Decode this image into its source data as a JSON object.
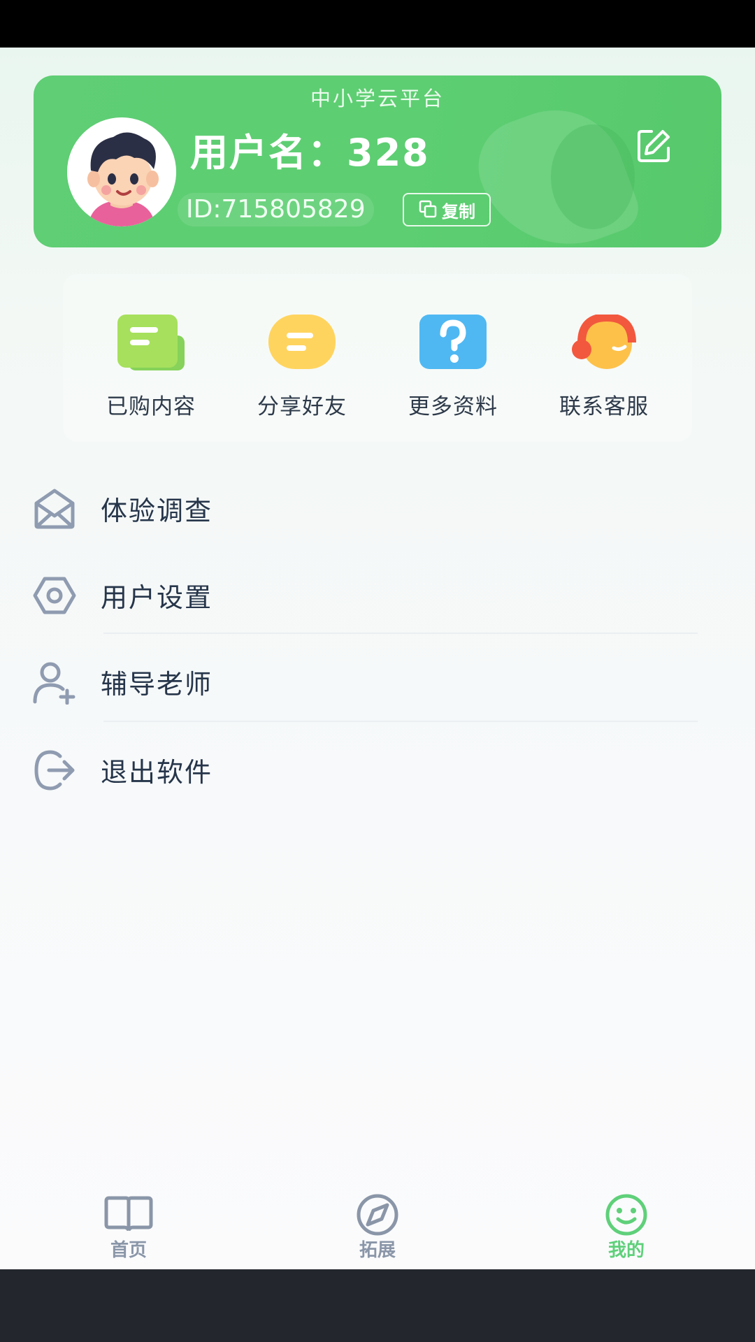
{
  "profile": {
    "platform_title": "中小学云平台",
    "username": "用户名：328",
    "user_id": "ID:715805829",
    "copy_label": "复制"
  },
  "quick_actions": [
    {
      "label": "已购内容",
      "icon": "purchased-content-icon"
    },
    {
      "label": "分享好友",
      "icon": "share-friends-icon"
    },
    {
      "label": "更多资料",
      "icon": "question-mark-icon"
    },
    {
      "label": "联系客服",
      "icon": "headset-service-icon"
    }
  ],
  "menu": [
    {
      "label": "体验调查",
      "icon": "envelope-icon"
    },
    {
      "label": "用户设置",
      "icon": "hexagon-settings-icon"
    },
    {
      "label": "辅导老师",
      "icon": "user-add-icon"
    },
    {
      "label": "退出软件",
      "icon": "logout-icon"
    }
  ],
  "bottom_nav": [
    {
      "label": "首页",
      "icon": "book-icon",
      "active": false
    },
    {
      "label": "拓展",
      "icon": "compass-icon",
      "active": false
    },
    {
      "label": "我的",
      "icon": "smiley-icon",
      "active": true
    }
  ],
  "colors": {
    "brand_green": "#5dce72",
    "nav_inactive": "#8a96a8",
    "nav_active": "#5fd07a"
  }
}
